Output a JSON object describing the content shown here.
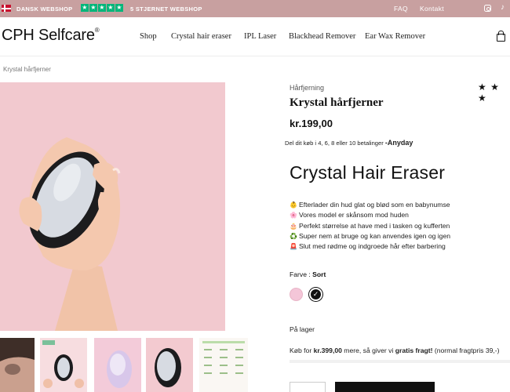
{
  "topbar": {
    "shop_label": "DANSK WEBSHOP",
    "trust_label": "5 STJERNET WEBSHOP",
    "faq": "FAQ",
    "contact": "Kontakt",
    "bg_color": "#c8a0a0",
    "trust_color": "#00b67a",
    "icons": [
      "danish-flag-icon",
      "star-icon",
      "instagram-icon",
      "tiktok-icon"
    ]
  },
  "header": {
    "logo": "CPH Selfcare",
    "logo_mark": "®",
    "nav": [
      "Shop",
      "Crystal hair eraser",
      "IPL Laser",
      "Blackhead Remover",
      "Ear Wax Remover"
    ],
    "cart_icon": "bag-icon"
  },
  "breadcrumb": "Krystal hårfjerner",
  "product": {
    "category": "Hårfjerning",
    "rating_stars": "★ ★ ★",
    "title": "Krystal hårfjerner",
    "price": "kr.199,00",
    "split_text": "Del dit køb i 4, 6, 8 eller 10 betalinger",
    "split_provider": "Anyday",
    "hero_title": "Crystal Hair Eraser",
    "features": [
      {
        "icon": "👶",
        "text": "Efterlader din hud glat og blød som en babynumse"
      },
      {
        "icon": "🌸",
        "text": "Vores model er skånsom mod huden"
      },
      {
        "icon": "🎂",
        "text": "Perfekt størrelse at have med i tasken og kufferten"
      },
      {
        "icon": "♻️",
        "text": "Super nem at bruge og kan anvendes igen og igen"
      },
      {
        "icon": "🚨",
        "text": "Slut med rødme og indgroede hår efter barbering"
      }
    ],
    "color_label": "Farve : ",
    "color_value": "Sort",
    "swatches": [
      {
        "name": "pink",
        "hex": "#f4c6d8"
      },
      {
        "name": "sort",
        "hex": "#111111"
      }
    ],
    "stock": "På lager",
    "ship_prefix": "Køb for ",
    "ship_amount": "kr.399,00",
    "ship_middle": " mere, så giver vi ",
    "ship_bold": "gratis fragt!",
    "ship_suffix": " (normal fragtpris 39,-)",
    "accent_pink": "#f2c9cf"
  }
}
